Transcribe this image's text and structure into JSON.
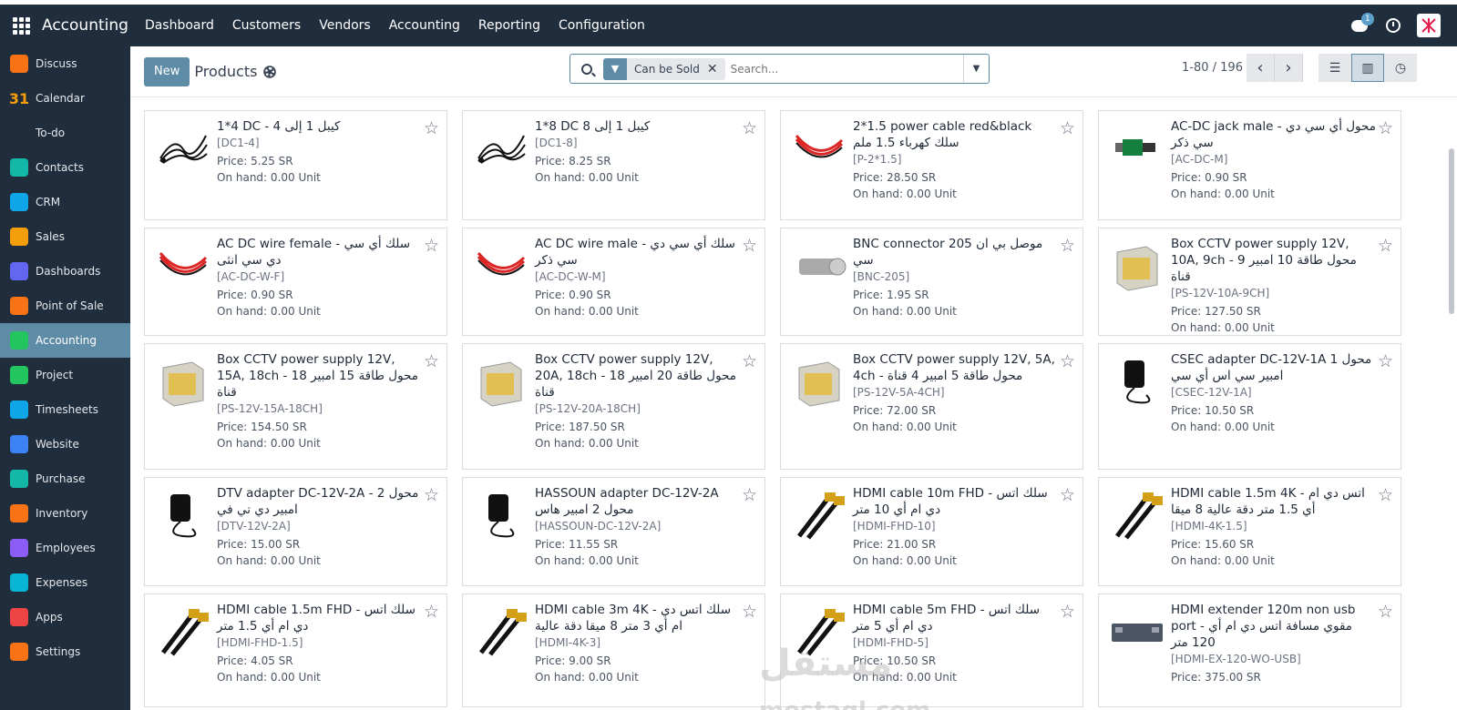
{
  "topbar": {
    "brand": "Accounting",
    "menu": [
      "Dashboard",
      "Customers",
      "Vendors",
      "Accounting",
      "Reporting",
      "Configuration"
    ],
    "chat_badge": "1"
  },
  "sidebar": {
    "items": [
      {
        "label": "Discuss",
        "icon": "discuss-icon",
        "color": "#f97316"
      },
      {
        "label": "Calendar",
        "icon": "calendar-icon",
        "color": "#1f2d3d",
        "glyph": "31"
      },
      {
        "label": "To-do",
        "icon": "todo-icon",
        "color": "#1f2d3d"
      },
      {
        "label": "Contacts",
        "icon": "contacts-icon",
        "color": "#14b8a6"
      },
      {
        "label": "CRM",
        "icon": "crm-icon",
        "color": "#0ea5e9"
      },
      {
        "label": "Sales",
        "icon": "sales-icon",
        "color": "#f59e0b"
      },
      {
        "label": "Dashboards",
        "icon": "dashboards-icon",
        "color": "#6366f1"
      },
      {
        "label": "Point of Sale",
        "icon": "pos-icon",
        "color": "#f97316"
      },
      {
        "label": "Accounting",
        "icon": "accounting-icon",
        "color": "#22c55e",
        "active": true
      },
      {
        "label": "Project",
        "icon": "project-icon",
        "color": "#22c55e"
      },
      {
        "label": "Timesheets",
        "icon": "timesheets-icon",
        "color": "#0ea5e9"
      },
      {
        "label": "Website",
        "icon": "website-icon",
        "color": "#3b82f6"
      },
      {
        "label": "Purchase",
        "icon": "purchase-icon",
        "color": "#14b8a6"
      },
      {
        "label": "Inventory",
        "icon": "inventory-icon",
        "color": "#f97316"
      },
      {
        "label": "Employees",
        "icon": "employees-icon",
        "color": "#8b5cf6"
      },
      {
        "label": "Expenses",
        "icon": "expenses-icon",
        "color": "#06b6d4"
      },
      {
        "label": "Apps",
        "icon": "apps-icon",
        "color": "#ef4444"
      },
      {
        "label": "Settings",
        "icon": "settings-icon",
        "color": "#f97316"
      }
    ]
  },
  "control": {
    "new_label": "New",
    "title": "Products",
    "facet_label": "Can be Sold",
    "search_placeholder": "Search...",
    "pager": "1-80 / 196"
  },
  "products": [
    {
      "name": "1*4 DC - كيبل 1 إلى 4",
      "code": "[DC1-4]",
      "price": "Price: 5.25 SR",
      "onhand": "On hand: 0.00 Unit"
    },
    {
      "name": "1*8 DC كيبل 1 إلى 8",
      "code": "[DC1-8]",
      "price": "Price: 8.25 SR",
      "onhand": "On hand: 0.00 Unit"
    },
    {
      "name": "2*1.5 power cable red&black سلك كهرباء 1.5 ملم",
      "code": "[P-2*1.5]",
      "price": "Price: 28.50 SR",
      "onhand": "On hand: 0.00 Unit"
    },
    {
      "name": "AC-DC jack male - محول أي سي دي سي ذكر",
      "code": "[AC-DC-M]",
      "price": "Price: 0.90 SR",
      "onhand": "On hand: 0.00 Unit"
    },
    {
      "name": "AC DC wire female - سلك أي سي دي سي انثى",
      "code": "[AC-DC-W-F]",
      "price": "Price: 0.90 SR",
      "onhand": "On hand: 0.00 Unit"
    },
    {
      "name": "AC DC wire male - سلك أي سي دي سي ذكر",
      "code": "[AC-DC-W-M]",
      "price": "Price: 0.90 SR",
      "onhand": "On hand: 0.00 Unit"
    },
    {
      "name": "BNC connector 205 موصل بي ان سي",
      "code": "[BNC-205]",
      "price": "Price: 1.95 SR",
      "onhand": "On hand: 0.00 Unit"
    },
    {
      "name": "Box CCTV power supply 12V, 10A, 9ch - محول طاقة 10 امبير 9 قناة",
      "code": "[PS-12V-10A-9CH]",
      "price": "Price: 127.50 SR",
      "onhand": "On hand: 0.00 Unit"
    },
    {
      "name": "Box CCTV power supply 12V, 15A, 18ch - محول طاقة 15 امبير 18 قناة",
      "code": "[PS-12V-15A-18CH]",
      "price": "Price: 154.50 SR",
      "onhand": "On hand: 0.00 Unit"
    },
    {
      "name": "Box CCTV power supply 12V, 20A, 18ch - محول طاقة 20 امبير 18 قناة",
      "code": "[PS-12V-20A-18CH]",
      "price": "Price: 187.50 SR",
      "onhand": "On hand: 0.00 Unit"
    },
    {
      "name": "Box CCTV power supply 12V, 5A, 4ch - محول طاقة 5 امبير 4 قناة",
      "code": "[PS-12V-5A-4CH]",
      "price": "Price: 72.00 SR",
      "onhand": "On hand: 0.00 Unit"
    },
    {
      "name": "CSEC adapter DC-12V-1A محول 1 امبير سي اس أي سي",
      "code": "[CSEC-12V-1A]",
      "price": "Price: 10.50 SR",
      "onhand": "On hand: 0.00 Unit"
    },
    {
      "name": "DTV adapter DC-12V-2A - محول 2 امبير دي تي في",
      "code": "[DTV-12V-2A]",
      "price": "Price: 15.00 SR",
      "onhand": "On hand: 0.00 Unit"
    },
    {
      "name": "HASSOUN adapter DC-12V-2A محول 2 امبير هاس",
      "code": "[HASSOUN-DC-12V-2A]",
      "price": "Price: 11.55 SR",
      "onhand": "On hand: 0.00 Unit"
    },
    {
      "name": "HDMI cable 10m FHD - سلك اتس دي ام أي 10 متر",
      "code": "[HDMI-FHD-10]",
      "price": "Price: 21.00 SR",
      "onhand": "On hand: 0.00 Unit"
    },
    {
      "name": "HDMI cable 1.5m 4K - اتس دي ام أي 1.5 متر دقة عالية 8 ميقا",
      "code": "[HDMI-4K-1.5]",
      "price": "Price: 15.60 SR",
      "onhand": "On hand: 0.00 Unit"
    },
    {
      "name": "HDMI cable 1.5m FHD - سلك اتس دي ام أي 1.5 متر",
      "code": "[HDMI-FHD-1.5]",
      "price": "Price: 4.05 SR",
      "onhand": "On hand: 0.00 Unit"
    },
    {
      "name": "HDMI cable 3m 4K - سلك اتس دي ام أي 3 متر 8 ميقا دقة عالية",
      "code": "[HDMI-4K-3]",
      "price": "Price: 9.00 SR",
      "onhand": "On hand: 0.00 Unit"
    },
    {
      "name": "HDMI cable 5m FHD - سلك اتس دي ام أي 5 متر",
      "code": "[HDMI-FHD-5]",
      "price": "Price: 10.50 SR",
      "onhand": "On hand: 0.00 Unit"
    },
    {
      "name": "HDMI extender 120m non usb port - مقوي مسافة اتس دي ام أي 120 متر",
      "code": "[HDMI-EX-120-WO-USB]",
      "price": "Price: 375.00 SR",
      "onhand": ""
    }
  ],
  "watermark": {
    "line1": "مستقل",
    "line2": "mostaql.com"
  }
}
